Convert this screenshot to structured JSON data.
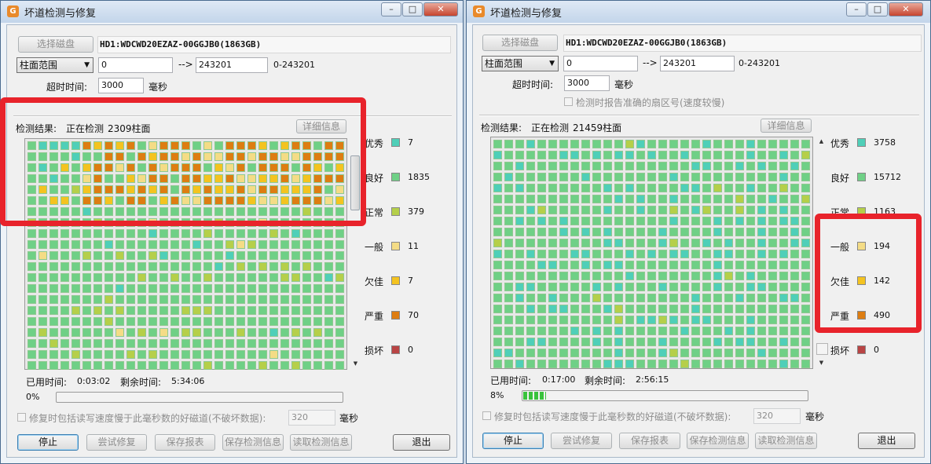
{
  "left_window": {
    "title": "坏道检测与修复",
    "select_disk_label": "选择磁盘",
    "disk_name": "HD1:WDCWD20EZAZ-00GGJB0(1863GB)",
    "range_type": "柱面范围",
    "range_start": "0",
    "range_arrow": "-->",
    "range_end": "243201",
    "range_hint": "0-243201",
    "timeout_label": "超时时间:",
    "timeout_value": "3000",
    "timeout_unit": "毫秒",
    "result_label": "检测结果:",
    "status_text": "正在检测",
    "cylinders_text": "2309柱面",
    "detail_button": "详细信息",
    "legend": [
      {
        "label": "优秀",
        "count": "7",
        "color": "#4fcfb8"
      },
      {
        "label": "良好",
        "count": "1835",
        "color": "#6fd086"
      },
      {
        "label": "正常",
        "count": "379",
        "color": "#b5cf4a"
      },
      {
        "label": "一般",
        "count": "11",
        "color": "#f4dc86"
      },
      {
        "label": "欠佳",
        "count": "7",
        "color": "#f4c320"
      },
      {
        "label": "严重",
        "count": "70",
        "color": "#dd7d12"
      },
      {
        "label": "损坏",
        "count": "0",
        "color": "#b94444"
      }
    ],
    "elapsed_label": "已用时间:",
    "elapsed_value": "0:03:02",
    "remaining_label": "剩余时间:",
    "remaining_value": "5:34:06",
    "progress_text": "0%",
    "progress_fraction": 0,
    "repair_option_text": "修复时包括读写速度慢于此毫秒数的好磁道(不破坏数据):",
    "repair_ms_value": "320",
    "repair_ms_unit": "毫秒",
    "buttons": {
      "stop": "停止",
      "try_repair": "尝试修复",
      "save_report": "保存报表",
      "save_info": "保存检测信息",
      "load_info": "读取检测信息",
      "exit": "退出"
    }
  },
  "right_window": {
    "title": "坏道检测与修复",
    "select_disk_label": "选择磁盘",
    "disk_name": "HD1:WDCWD20EZAZ-00GGJB0(1863GB)",
    "range_type": "柱面范围",
    "range_start": "0",
    "range_arrow": "-->",
    "range_end": "243201",
    "range_hint": "0-243201",
    "timeout_label": "超时时间:",
    "timeout_value": "3000",
    "timeout_unit": "毫秒",
    "precise_sector_text": "检测时报告准确的扇区号(速度较慢)",
    "result_label": "检测结果:",
    "status_text": "正在检测",
    "cylinders_text": "21459柱面",
    "detail_button": "详细信息",
    "legend": [
      {
        "label": "优秀",
        "count": "3758",
        "color": "#4fcfb8"
      },
      {
        "label": "良好",
        "count": "15712",
        "color": "#6fd086"
      },
      {
        "label": "正常",
        "count": "1163",
        "color": "#b5cf4a"
      },
      {
        "label": "一般",
        "count": "194",
        "color": "#f4dc86"
      },
      {
        "label": "欠佳",
        "count": "142",
        "color": "#f4c320"
      },
      {
        "label": "严重",
        "count": "490",
        "color": "#dd7d12"
      },
      {
        "label": "损坏",
        "count": "0",
        "color": "#b94444"
      }
    ],
    "elapsed_label": "已用时间:",
    "elapsed_value": "0:17:00",
    "remaining_label": "剩余时间:",
    "remaining_value": "2:56:15",
    "progress_text": "8%",
    "progress_fraction": 0.08,
    "repair_option_text": "修复时包括读写速度慢于此毫秒数的好磁道(不破坏数据):",
    "repair_ms_value": "320",
    "repair_ms_unit": "毫秒",
    "buttons": {
      "stop": "停止",
      "try_repair": "尝试修复",
      "save_report": "保存报表",
      "save_info": "保存检测信息",
      "load_info": "读取检测信息",
      "exit": "退出"
    }
  }
}
